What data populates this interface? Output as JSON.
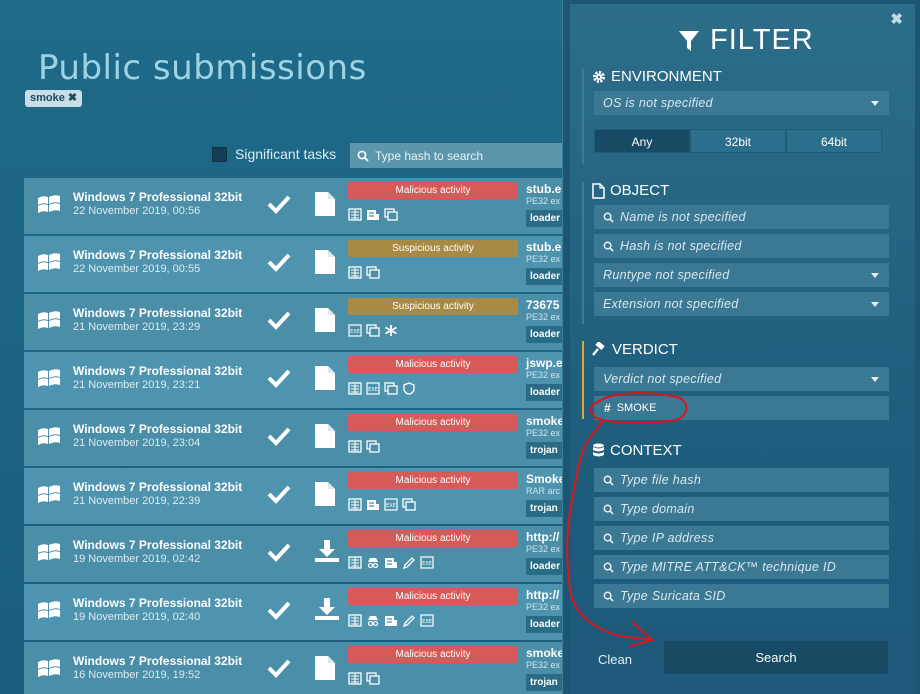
{
  "main": {
    "title": "Public submissions",
    "tag_chip": "smoke",
    "significant_label": "Significant tasks",
    "hash_placeholder": "Type hash to search"
  },
  "rows": [
    {
      "os": "Windows 7 Professional 32bit",
      "date": "22 November 2019, 00:56",
      "file_icon": "document-icon",
      "verdict": "Malicious activity",
      "verdict_kind": "malicious",
      "tags": [
        "network-icon",
        "script-icon",
        "window-icon"
      ],
      "name": "stub.e",
      "type": "PE32 ex",
      "badge": "loader"
    },
    {
      "os": "Windows 7 Professional 32bit",
      "date": "22 November 2019, 00:55",
      "file_icon": "document-icon",
      "verdict": "Suspicious activity",
      "verdict_kind": "suspicious",
      "tags": [
        "network-icon",
        "window-icon"
      ],
      "name": "stub.e",
      "type": "PE32 ex",
      "badge": "loader"
    },
    {
      "os": "Windows 7 Professional 32bit",
      "date": "21 November 2019, 23:29",
      "file_icon": "document-icon",
      "verdict": "Suspicious activity",
      "verdict_kind": "suspicious",
      "tags": [
        "exe-icon",
        "window-icon",
        "gear-icon"
      ],
      "name": "73675",
      "type": "PE32 ex",
      "badge": "loader"
    },
    {
      "os": "Windows 7 Professional 32bit",
      "date": "21 November 2019, 23:21",
      "file_icon": "document-icon",
      "verdict": "Malicious activity",
      "verdict_kind": "malicious",
      "tags": [
        "network-icon",
        "exe-icon",
        "window-icon",
        "shield-icon"
      ],
      "name": "jswp.e",
      "type": "PE32 ex",
      "badge": "loader"
    },
    {
      "os": "Windows 7 Professional 32bit",
      "date": "21 November 2019, 23:04",
      "file_icon": "document-icon",
      "verdict": "Malicious activity",
      "verdict_kind": "malicious",
      "tags": [
        "network-icon",
        "window-icon"
      ],
      "name": "smoke",
      "type": "PE32 ex",
      "badge": "trojan"
    },
    {
      "os": "Windows 7 Professional 32bit",
      "date": "21 November 2019, 22:39",
      "file_icon": "document-icon",
      "verdict": "Malicious activity",
      "verdict_kind": "malicious",
      "tags": [
        "network-icon",
        "script-icon",
        "exe-icon",
        "window-icon"
      ],
      "name": "Smoke",
      "type": "RAR arc",
      "badge": "trojan"
    },
    {
      "os": "Windows 7 Professional 32bit",
      "date": "19 November 2019, 02:42",
      "file_icon": "download-icon",
      "verdict": "Malicious activity",
      "verdict_kind": "malicious",
      "tags": [
        "network-icon",
        "spy-icon",
        "script-icon",
        "pen-icon",
        "exe-icon"
      ],
      "name": "http://",
      "type": "PE32 ex",
      "badge": "loader"
    },
    {
      "os": "Windows 7 Professional 32bit",
      "date": "19 November 2019, 02:40",
      "file_icon": "download-icon",
      "verdict": "Malicious activity",
      "verdict_kind": "malicious",
      "tags": [
        "network-icon",
        "spy-icon",
        "script-icon",
        "pen-icon",
        "exe-icon"
      ],
      "name": "http://",
      "type": "PE32 ex",
      "badge": "loader"
    },
    {
      "os": "Windows 7 Professional 32bit",
      "date": "16 November 2019, 19:52",
      "file_icon": "document-icon",
      "verdict": "Malicious activity",
      "verdict_kind": "malicious",
      "tags": [
        "network-icon",
        "window-icon"
      ],
      "name": "smoke",
      "type": "PE32 ex",
      "badge": "trojan"
    }
  ],
  "filter": {
    "title": "FILTER",
    "close": "✖",
    "environment": {
      "heading": "ENVIRONMENT",
      "os_select": "OS is not specified",
      "bitness": [
        "Any",
        "32bit",
        "64bit"
      ],
      "bitness_selected": "Any"
    },
    "object": {
      "heading": "OBJECT",
      "name_field": "Name is not specified",
      "hash_field": "Hash is not specified",
      "runtype_select": "Runtype not specified",
      "extension_select": "Extension not specified"
    },
    "verdict": {
      "heading": "VERDICT",
      "verdict_select": "Verdict not specified",
      "tag_chip": "SMOKE"
    },
    "context": {
      "heading": "CONTEXT",
      "file_hash": "Type file hash",
      "domain": "Type domain",
      "ip": "Type IP address",
      "mitre": "Type MITRE ATT&CK™ technique ID",
      "suricata": "Type Suricata SID"
    },
    "clean_label": "Clean",
    "search_label": "Search"
  },
  "colors": {
    "malicious": "#d65a57",
    "suspicious": "#a98a45",
    "verdict_accent": "#e0a534",
    "annotation": "#e0141c"
  }
}
